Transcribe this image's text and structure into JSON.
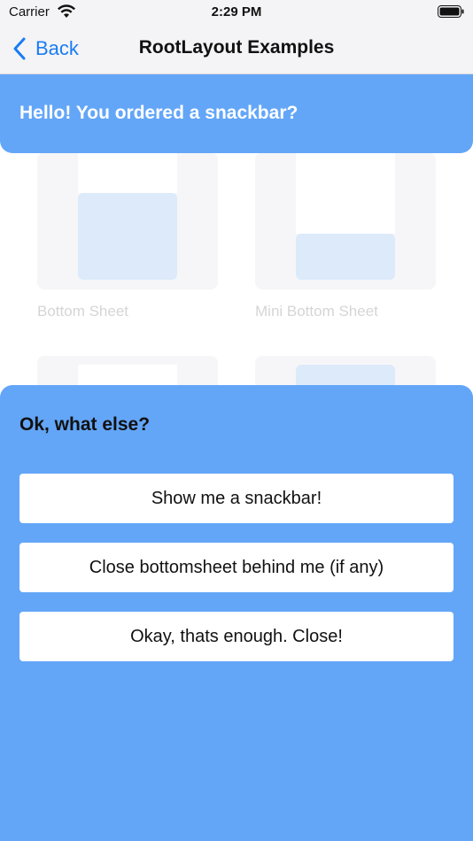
{
  "status_bar": {
    "carrier": "Carrier",
    "time": "2:29 PM"
  },
  "nav": {
    "back_label": "Back",
    "title": "RootLayout Examples"
  },
  "grid": {
    "items": [
      {
        "label": "Bottom Sheet"
      },
      {
        "label": "Mini Bottom Sheet"
      }
    ]
  },
  "snackbar": {
    "text": "Hello! You ordered a snackbar?"
  },
  "bottom_sheet": {
    "title": "Ok, what else?",
    "buttons": [
      {
        "label": "Show me a snackbar!"
      },
      {
        "label": "Close bottomsheet behind me (if any)"
      },
      {
        "label": "Okay, thats enough. Close!"
      }
    ]
  },
  "colors": {
    "accent": "#1a7cf2",
    "sheet": "#63a6f8",
    "card": "#e7e8ec"
  }
}
